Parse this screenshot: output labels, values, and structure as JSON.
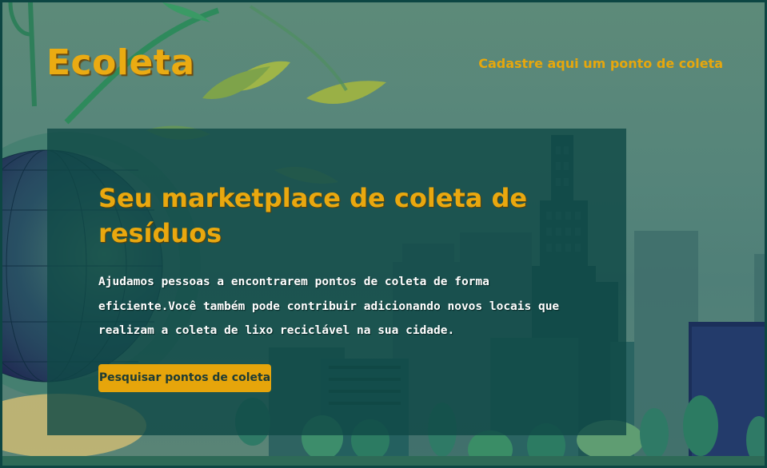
{
  "header": {
    "logo_text": "Ecoleta",
    "register_link": "Cadastre aqui um ponto de coleta"
  },
  "hero": {
    "title": "Seu marketplace de coleta de resíduos",
    "description": "Ajudamos pessoas a encontrarem pontos de coleta de forma eficiente.Você também pode contribuir adicionando novos locais que realizam a coleta de lixo reciclável na sua cidade.",
    "cta_button": "Pesquisar pontos de coleta"
  },
  "colors": {
    "accent": "#e6a50b",
    "panel": "#0f4846",
    "background": "#5d8a79"
  },
  "icons": [
    "leaf-branch-illustration",
    "globe-illustration",
    "city-skyline-illustration",
    "tree-illustration"
  ]
}
